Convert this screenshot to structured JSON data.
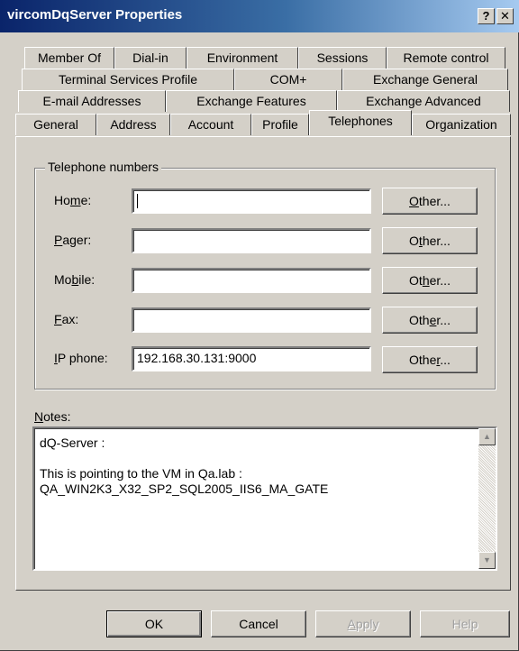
{
  "window": {
    "title": "vircomDqServer Properties",
    "help_glyph": "?",
    "close_glyph": "✕"
  },
  "tabs": {
    "row1": [
      "Member Of",
      "Dial-in",
      "Environment",
      "Sessions",
      "Remote control"
    ],
    "row2": [
      "Terminal Services Profile",
      "COM+",
      "Exchange General"
    ],
    "row3": [
      "E-mail Addresses",
      "Exchange Features",
      "Exchange Advanced"
    ],
    "row4": [
      "General",
      "Address",
      "Account",
      "Profile",
      "Telephones",
      "Organization"
    ],
    "active": "Telephones"
  },
  "telephone_group": {
    "legend": "Telephone numbers",
    "rows": [
      {
        "label_pre": "Ho",
        "label_key": "m",
        "label_post": "e:",
        "value": "",
        "button_pre": "",
        "button_key": "O",
        "button_post": "ther..."
      },
      {
        "label_pre": "",
        "label_key": "P",
        "label_post": "ager:",
        "value": "",
        "button_pre": "O",
        "button_key": "t",
        "button_post": "her..."
      },
      {
        "label_pre": "Mo",
        "label_key": "b",
        "label_post": "ile:",
        "value": "",
        "button_pre": "Ot",
        "button_key": "h",
        "button_post": "er..."
      },
      {
        "label_pre": "",
        "label_key": "F",
        "label_post": "ax:",
        "value": "",
        "button_pre": "Oth",
        "button_key": "e",
        "button_post": "r..."
      },
      {
        "label_pre": "",
        "label_key": "I",
        "label_post": "P phone:",
        "value": "192.168.30.131:9000",
        "button_pre": "Othe",
        "button_key": "r",
        "button_post": "..."
      }
    ]
  },
  "notes": {
    "label_key": "N",
    "label_post": "otes:",
    "text": "dQ-Server :\n\nThis is pointing to the VM in Qa.lab :\nQA_WIN2K3_X32_SP2_SQL2005_IIS6_MA_GATE",
    "scroll_up_glyph": "▲",
    "scroll_down_glyph": "▼"
  },
  "footer": {
    "ok": "OK",
    "cancel": "Cancel",
    "apply_key": "A",
    "apply_post": "pply",
    "help": "Help"
  },
  "colors": {
    "face": "#d4d0c8",
    "title_start": "#0a246a",
    "title_end": "#a6caf0"
  }
}
